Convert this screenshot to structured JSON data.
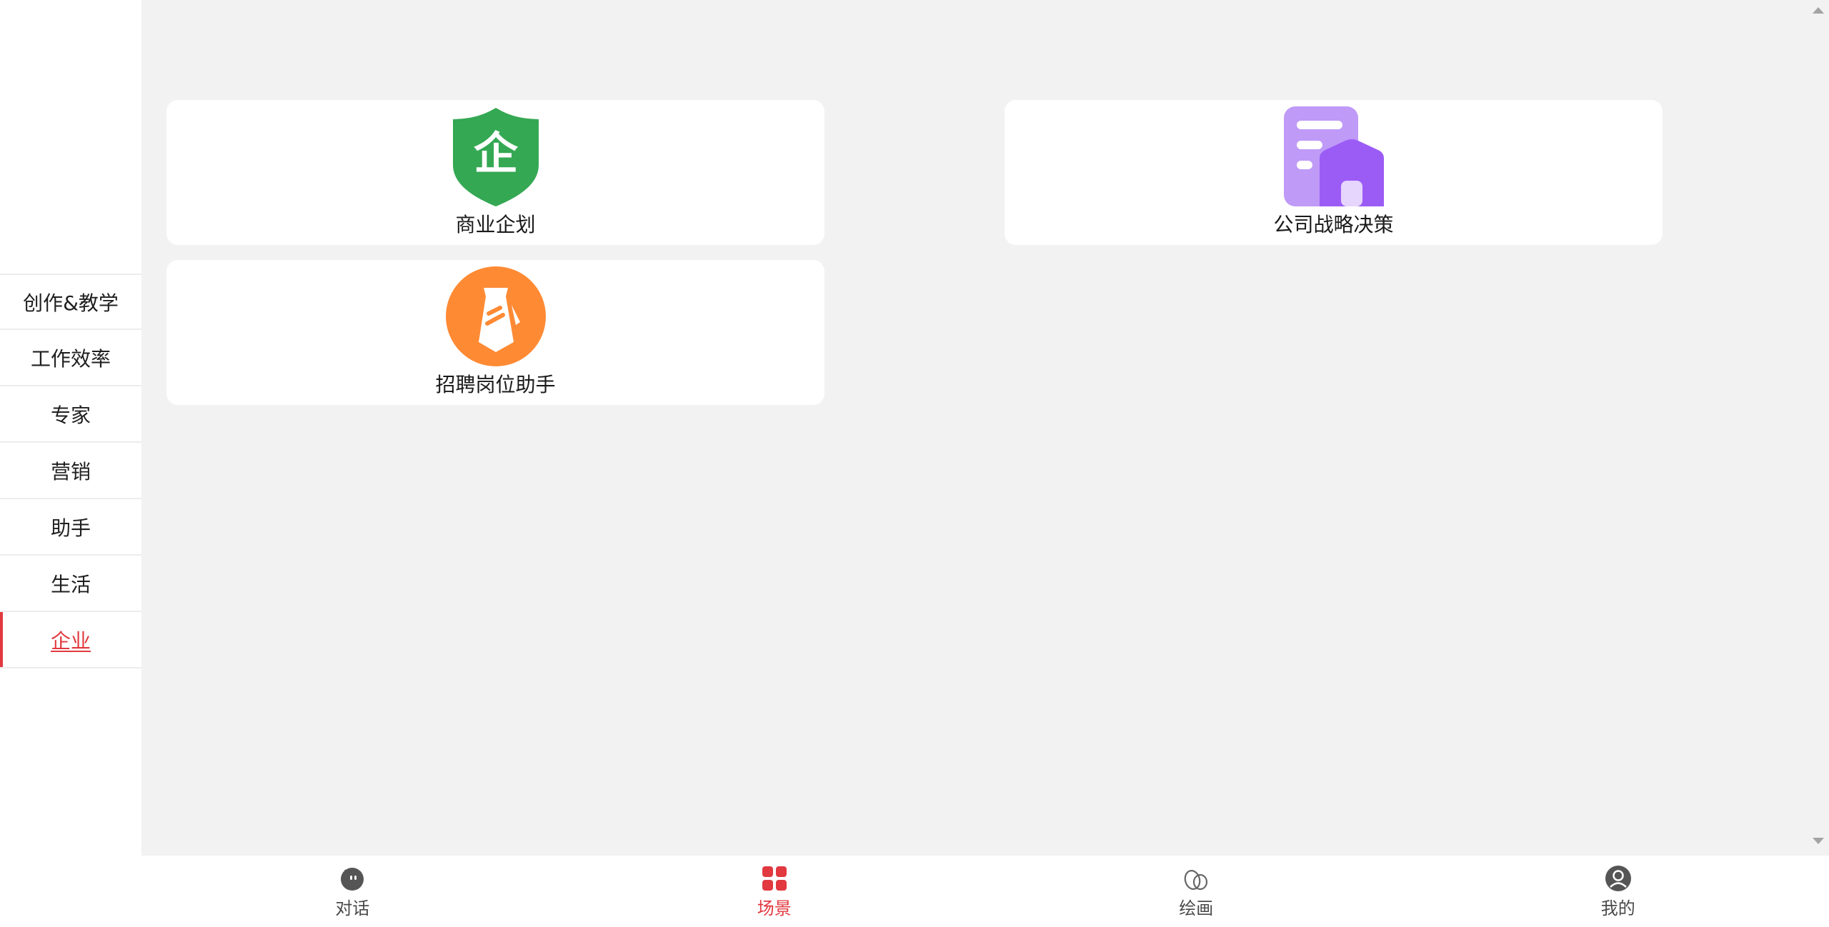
{
  "sidebar": {
    "items": [
      {
        "label": "创作&教学"
      },
      {
        "label": "工作效率"
      },
      {
        "label": "专家"
      },
      {
        "label": "营销"
      },
      {
        "label": "助手"
      },
      {
        "label": "生活"
      },
      {
        "label": "企业",
        "active": true
      }
    ]
  },
  "cards": [
    {
      "label": "商业企划",
      "icon": "enterprise-shield-icon",
      "icon_text": "企",
      "color": "#34a853"
    },
    {
      "label": "公司战略决策",
      "icon": "building-icon",
      "color": "#9b5cf6"
    },
    {
      "label": "招聘岗位助手",
      "icon": "necktie-icon",
      "color": "#ff8a34"
    }
  ],
  "tabbar": {
    "tabs": [
      {
        "label": "对话",
        "icon": "chat-bubble-icon"
      },
      {
        "label": "场景",
        "icon": "grid-icon",
        "active": true
      },
      {
        "label": "绘画",
        "icon": "palette-icon"
      },
      {
        "label": "我的",
        "icon": "user-icon"
      }
    ]
  },
  "colors": {
    "accent": "#e1393f",
    "background": "#f2f2f2",
    "card": "#ffffff"
  }
}
